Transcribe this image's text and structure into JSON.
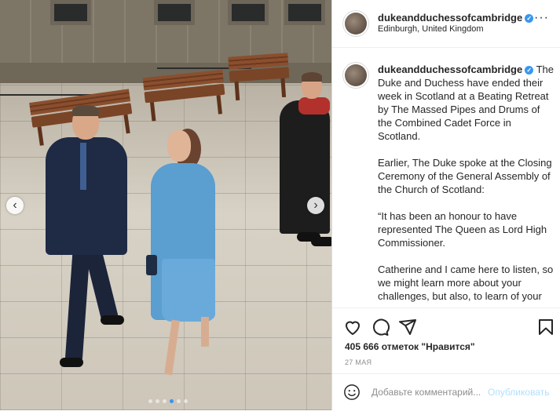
{
  "post": {
    "username": "dukeandduchessofcambridge",
    "location": "Edinburgh, United Kingdom",
    "caption": [
      "The Duke and Duchess have ended their week in Scotland at a Beating Retreat by The Massed Pipes and Drums of the Combined Cadet Force in Scotland.",
      "Earlier, The Duke spoke at the Closing Ceremony of the General Assembly of the Church of Scotland:",
      "“It has been an honour to have represented The Queen as Lord High Commissioner.",
      "Catherine and I came here to listen, so we might learn more about your challenges, but also, to learn of your hopes and aspirations, so that we may serve alongside you with the"
    ],
    "likes": "405 666 отметок \"Нравится\"",
    "date": "27 МАЯ"
  },
  "comment": {
    "placeholder": "Добавьте комментарий...",
    "publish_label": "Опубликовать"
  },
  "carousel": {
    "slide_count": 6,
    "active_index": 3
  },
  "icons": {
    "more": "more-options-icon",
    "like": "heart-icon",
    "comment": "comment-icon",
    "share": "share-icon",
    "save": "bookmark-icon",
    "emoji": "emoji-icon",
    "prev": "chevron-left-icon",
    "next": "chevron-right-icon",
    "verified": "verified-badge-icon"
  },
  "colors": {
    "verified": "#3897f0",
    "publish_disabled": "#b2dffc",
    "border": "#dbdbdb"
  }
}
